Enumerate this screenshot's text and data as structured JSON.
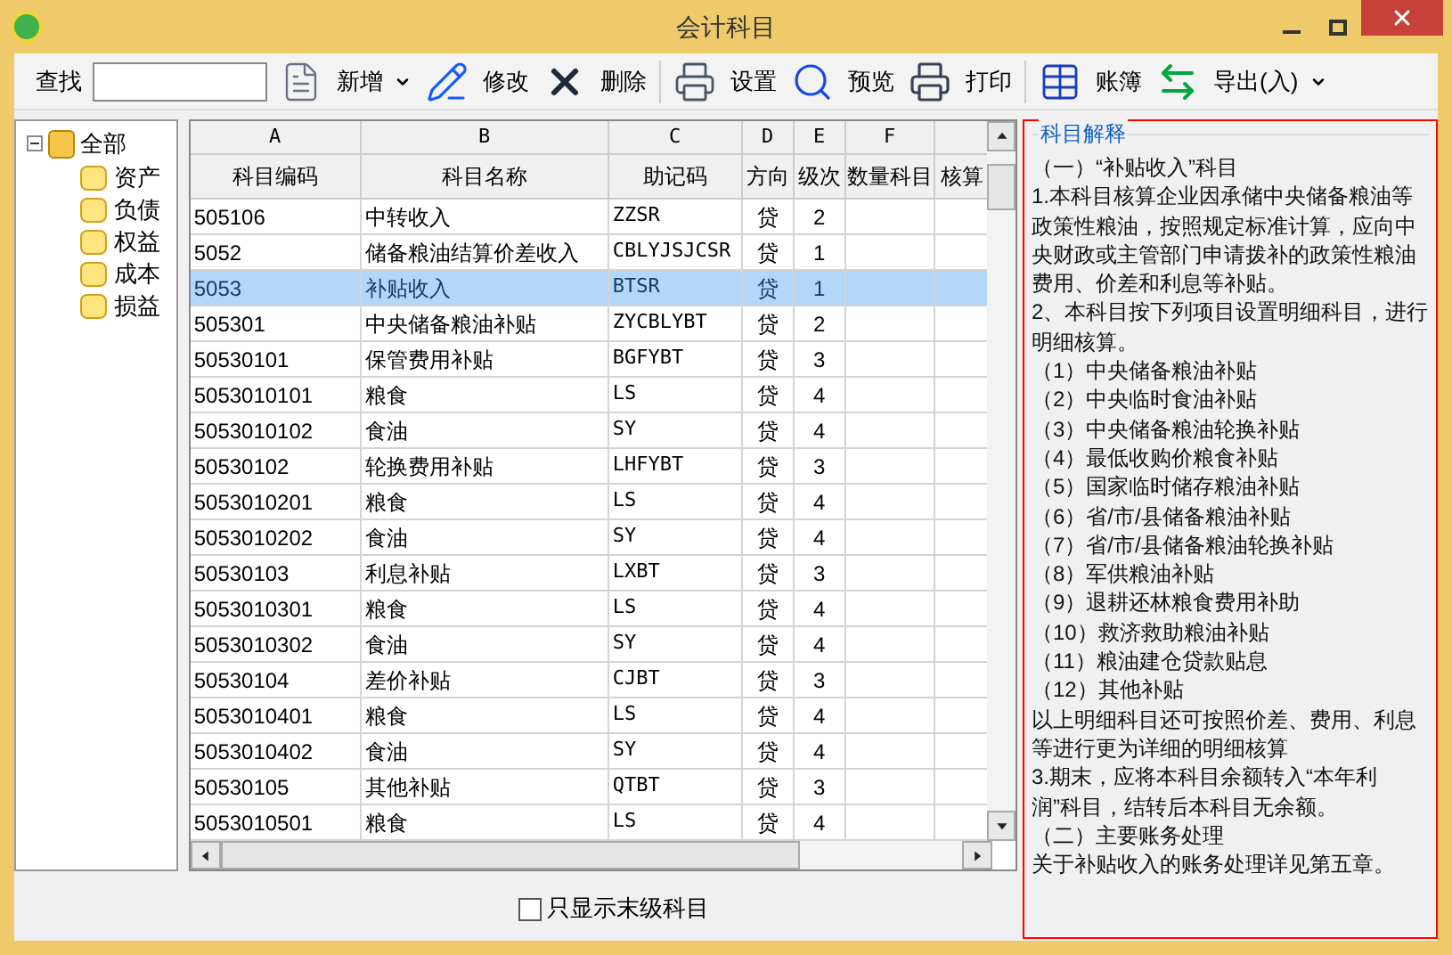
{
  "window": {
    "title": "会计科目"
  },
  "toolbar": {
    "search_label": "查找",
    "items": [
      {
        "kind": "new",
        "label": "新增",
        "dropdown": true
      },
      {
        "kind": "edit",
        "label": "修改",
        "dropdown": false
      },
      {
        "kind": "delete",
        "label": "删除",
        "dropdown": false
      },
      {
        "kind": "setup",
        "label": "设置",
        "dropdown": false
      },
      {
        "kind": "preview",
        "label": "预览",
        "dropdown": false
      },
      {
        "kind": "print",
        "label": "打印",
        "dropdown": false
      },
      {
        "kind": "ledger",
        "label": "账簿",
        "dropdown": false
      },
      {
        "kind": "export",
        "label": "导出(入)",
        "dropdown": true
      }
    ]
  },
  "tree": {
    "label": "全部",
    "expanded": true,
    "children": [
      {
        "label": "资产"
      },
      {
        "label": "负债"
      },
      {
        "label": "权益"
      },
      {
        "label": "成本"
      },
      {
        "label": "损益"
      }
    ]
  },
  "table": {
    "columns": [
      {
        "letter": "A",
        "title": "科目编码"
      },
      {
        "letter": "B",
        "title": "科目名称"
      },
      {
        "letter": "C",
        "title": "助记码"
      },
      {
        "letter": "D",
        "title": "方向"
      },
      {
        "letter": "E",
        "title": "级次"
      },
      {
        "letter": "F",
        "title": "数量科目"
      },
      {
        "title": "核算"
      }
    ],
    "rows": [
      {
        "selected": false,
        "cells": [
          "505106",
          "中转收入",
          "ZZSR",
          "贷",
          "2"
        ]
      },
      {
        "selected": false,
        "cells": [
          "5052",
          "储备粮油结算价差收入",
          "CBLYJSJCSR",
          "贷",
          "1"
        ]
      },
      {
        "selected": true,
        "cells": [
          "5053",
          "补贴收入",
          "BTSR",
          "贷",
          "1"
        ]
      },
      {
        "selected": false,
        "cells": [
          "505301",
          "中央储备粮油补贴",
          "ZYCBLYBT",
          "贷",
          "2"
        ]
      },
      {
        "selected": false,
        "cells": [
          "50530101",
          "保管费用补贴",
          "BGFYBT",
          "贷",
          "3"
        ]
      },
      {
        "selected": false,
        "cells": [
          "5053010101",
          "粮食",
          "LS",
          "贷",
          "4"
        ]
      },
      {
        "selected": false,
        "cells": [
          "5053010102",
          "食油",
          "SY",
          "贷",
          "4"
        ]
      },
      {
        "selected": false,
        "cells": [
          "50530102",
          "轮换费用补贴",
          "LHFYBT",
          "贷",
          "3"
        ]
      },
      {
        "selected": false,
        "cells": [
          "5053010201",
          "粮食",
          "LS",
          "贷",
          "4"
        ]
      },
      {
        "selected": false,
        "cells": [
          "5053010202",
          "食油",
          "SY",
          "贷",
          "4"
        ]
      },
      {
        "selected": false,
        "cells": [
          "50530103",
          "利息补贴",
          "LXBT",
          "贷",
          "3"
        ]
      },
      {
        "selected": false,
        "cells": [
          "5053010301",
          "粮食",
          "LS",
          "贷",
          "4"
        ]
      },
      {
        "selected": false,
        "cells": [
          "5053010302",
          "食油",
          "SY",
          "贷",
          "4"
        ]
      },
      {
        "selected": false,
        "cells": [
          "50530104",
          "差价补贴",
          "CJBT",
          "贷",
          "3"
        ]
      },
      {
        "selected": false,
        "cells": [
          "5053010401",
          "粮食",
          "LS",
          "贷",
          "4"
        ]
      },
      {
        "selected": false,
        "cells": [
          "5053010402",
          "食油",
          "SY",
          "贷",
          "4"
        ]
      },
      {
        "selected": false,
        "cells": [
          "50530105",
          "其他补贴",
          "QTBT",
          "贷",
          "3"
        ]
      },
      {
        "selected": false,
        "cells": [
          "5053010501",
          "粮食",
          "LS",
          "贷",
          "4"
        ]
      }
    ]
  },
  "leaf_only": {
    "label": "只显示末级科目",
    "checked": false
  },
  "explanation": {
    "title": "科目解释",
    "lines": [
      "（一）“补贴收入”科目",
      "1.本科目核算企业因承储中央储备粮油等",
      "政策性粮油，按照规定标准计算，应向中",
      "央财政或主管部门申请拨补的政策性粮油",
      "费用、价差和利息等补贴。",
      "2、本科目按下列项目设置明细科目，进行",
      "明细核算。",
      "（1）中央储备粮油补贴",
      "（2）中央临时食油补贴",
      "（3）中央储备粮油轮换补贴",
      "（4）最低收购价粮食补贴",
      "（5）国家临时储存粮油补贴",
      "（6）省/市/县储备粮油补贴",
      "（7）省/市/县储备粮油轮换补贴",
      "（8）军供粮油补贴",
      "（9）退耕还林粮食费用补助",
      "（10）救济救助粮油补贴",
      "（11）粮油建仓贷款贴息",
      "（12）其他补贴",
      "以上明细科目还可按照价差、费用、利息",
      "等进行更为详细的明细核算",
      "3.期末，应将本科目余额转入“本年利",
      "润”科目，结转后本科目无余额。",
      "（二）主要账务处理",
      "关于补贴收入的账务处理详见第五章。"
    ]
  }
}
